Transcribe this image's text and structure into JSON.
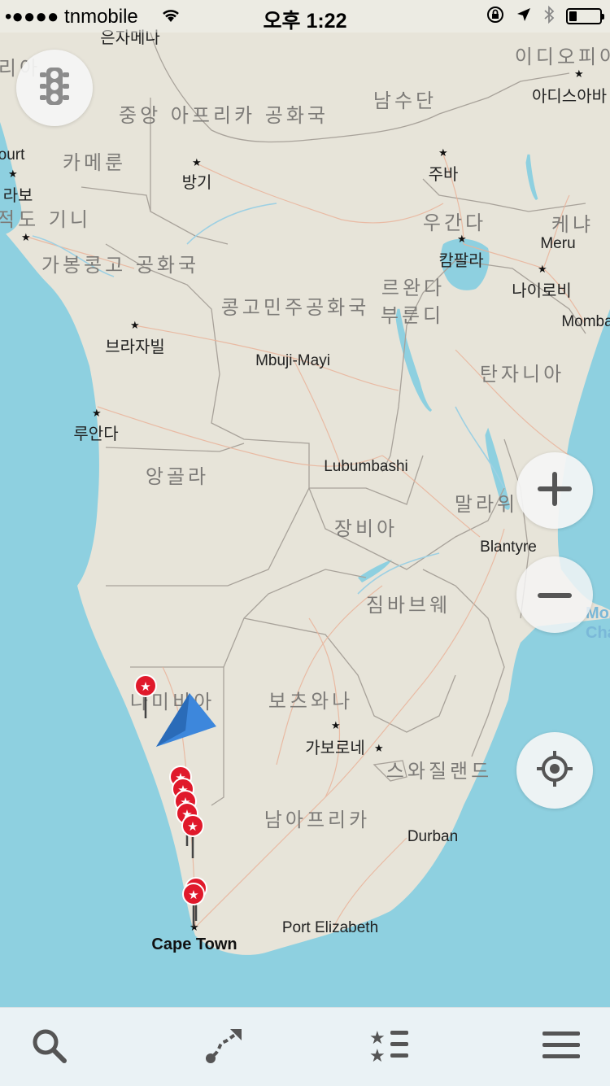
{
  "status_bar": {
    "carrier": "•●●●● tnmobile",
    "time": "오후 1:22",
    "battery_level": 0.25
  },
  "map": {
    "country_labels": [
      {
        "id": "car",
        "text": "중앙 아프리카 공화국"
      },
      {
        "id": "ssd",
        "text": "남수단"
      },
      {
        "id": "eth",
        "text": "이디오피아"
      },
      {
        "id": "cmr",
        "text": "카메룬"
      },
      {
        "id": "uga",
        "text": "우간다"
      },
      {
        "id": "ken",
        "text": "케냐"
      },
      {
        "id": "gnq",
        "text": "적도 기니"
      },
      {
        "id": "cog",
        "text": "가봉콩고 공화국"
      },
      {
        "id": "cod",
        "text": "콩고민주공화국"
      },
      {
        "id": "rwa",
        "text": "르완다"
      },
      {
        "id": "bdi",
        "text": "부룬디"
      },
      {
        "id": "tza",
        "text": "탄자니아"
      },
      {
        "id": "ago",
        "text": "앙골라"
      },
      {
        "id": "zmb",
        "text": "장비아"
      },
      {
        "id": "mwi",
        "text": "말라위"
      },
      {
        "id": "zwe",
        "text": "짐바브웨"
      },
      {
        "id": "nam",
        "text": "나미비아"
      },
      {
        "id": "bwa",
        "text": "보츠와나"
      },
      {
        "id": "swz",
        "text": "스와질랜드"
      },
      {
        "id": "zaf",
        "text": "남아프리카"
      },
      {
        "id": "nga",
        "text": "리아"
      }
    ],
    "city_labels": [
      {
        "id": "bangui",
        "text": "방기"
      },
      {
        "id": "juba",
        "text": "주바"
      },
      {
        "id": "addis",
        "text": "아디스아바"
      },
      {
        "id": "kampala",
        "text": "캄팔라"
      },
      {
        "id": "nairobi",
        "text": "나이로비"
      },
      {
        "id": "meru",
        "text": "Meru"
      },
      {
        "id": "mombasa",
        "text": "Momba"
      },
      {
        "id": "brazzaville",
        "text": "브라자빌"
      },
      {
        "id": "mbuji",
        "text": "Mbuji-Mayi"
      },
      {
        "id": "luanda",
        "text": "루안다"
      },
      {
        "id": "lubumbashi",
        "text": "Lubumbashi"
      },
      {
        "id": "blantyre",
        "text": "Blantyre"
      },
      {
        "id": "gaborone",
        "text": "가보로네"
      },
      {
        "id": "durban",
        "text": "Durban"
      },
      {
        "id": "pe",
        "text": "Port Elizabeth"
      },
      {
        "id": "capetown",
        "text": "Cape Town"
      },
      {
        "id": "malabo",
        "text": "라보"
      },
      {
        "id": "harcourt",
        "text": "ourt"
      },
      {
        "id": "eunjamena",
        "text": "은자메나"
      },
      {
        "id": "mozambique",
        "text": "Mozamb Chann"
      }
    ]
  },
  "controls": {
    "traffic": "traffic-light-icon",
    "zoom_in": "+",
    "zoom_out": "−",
    "locate": "locate-icon"
  },
  "tab_bar": [
    {
      "id": "search",
      "icon": "search-icon"
    },
    {
      "id": "route",
      "icon": "route-icon"
    },
    {
      "id": "bookmarks",
      "icon": "bookmarks-icon"
    },
    {
      "id": "menu",
      "icon": "menu-icon"
    }
  ],
  "colors": {
    "land": "#e7e4d9",
    "water": "#8ed0e0",
    "pin": "#e0192b",
    "arrow": "#2f7ad6",
    "tabbar": "#eaf2f5"
  }
}
